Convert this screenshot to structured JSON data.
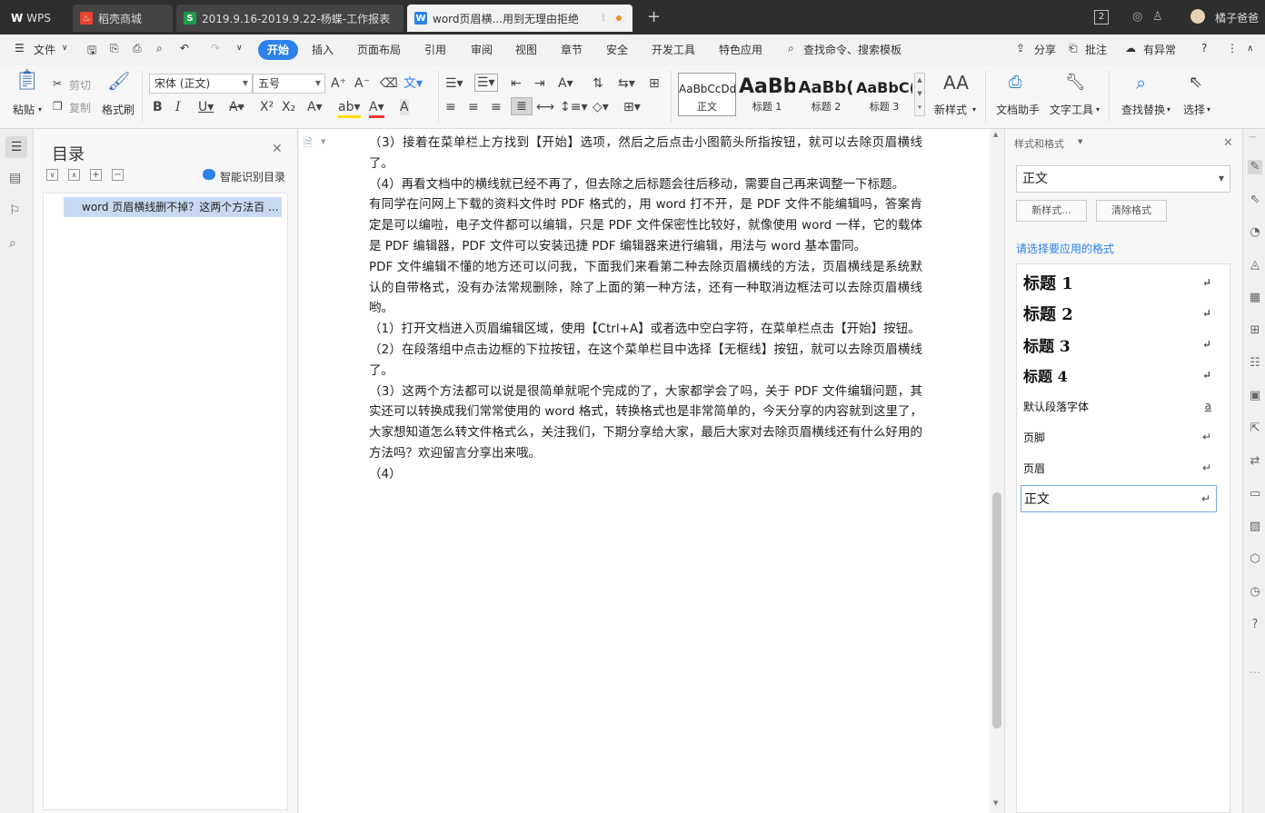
{
  "titlebar": {
    "tabs": [
      {
        "label": "WPS",
        "icon": "wps-logo-icon"
      },
      {
        "label": "稻壳商城",
        "icon": "docer-flame-icon"
      },
      {
        "label": "2019.9.16-2019.9.22-杨蝶-工作报表",
        "icon": "sheet-s-icon"
      },
      {
        "label": "word页眉横...用到无理由拒绝",
        "icon": "writer-w-icon"
      }
    ],
    "new_tab": "+",
    "window_count": "2",
    "user_name": "橘子爸爸"
  },
  "menubar": {
    "file": "文件",
    "tabs": [
      "开始",
      "插入",
      "页面布局",
      "引用",
      "审阅",
      "视图",
      "章节",
      "安全",
      "开发工具",
      "特色应用"
    ],
    "search_placeholder": "查找命令、搜索模板",
    "share": "分享",
    "comment": "批注",
    "anomaly": "有异常",
    "help": "?"
  },
  "ribbon": {
    "paste": "粘贴",
    "cut": "剪切",
    "copy": "复制",
    "format_painter": "格式刷",
    "font_name": "宋体 (正文)",
    "font_size": "五号",
    "styles": [
      {
        "preview": "AaBbCcDd",
        "name": "正文"
      },
      {
        "preview": "AaBb",
        "name": "标题 1"
      },
      {
        "preview": "AaBb(",
        "name": "标题 2"
      },
      {
        "preview": "AaBbC(",
        "name": "标题 3"
      }
    ],
    "new_style": "新样式",
    "doc_assistant": "文档助手",
    "text_tools": "文字工具",
    "find_replace": "查找替换",
    "select": "选择"
  },
  "toc": {
    "title": "目录",
    "smart_detect": "智能识别目录",
    "items": [
      "word 页眉横线删不掉？这两个方法百 ..."
    ]
  },
  "document": {
    "paragraphs": [
      "（3）接着在菜单栏上方找到【开始】选项，然后之后点击小图箭头所指按钮，就可以去除页眉横线了。",
      "（4）再看文档中的横线就已经不再了，但去除之后标题会往后移动，需要自己再来调整一下标题。",
      "有同学在问网上下载的资料文件时 PDF 格式的，用 word 打不开，是 PDF 文件不能编辑吗，答案肯定是可以编啦，电子文件都可以编辑，只是 PDF 文件保密性比较好，就像使用 word 一样，它的载体是 PDF 编辑器，PDF 文件可以安装迅捷 PDF 编辑器来进行编辑，用法与 word 基本雷同。",
      "PDF 文件编辑不懂的地方还可以问我，下面我们来看第二种去除页眉横线的方法，页眉横线是系统默认的自带格式，没有办法常规删除，除了上面的第一种方法，还有一种取消边框法可以去除页眉横线哟。",
      "（1）打开文档进入页眉编辑区域，使用【Ctrl+A】或者选中空白字符，在菜单栏点击【开始】按钮。",
      "（2）在段落组中点击边框的下拉按钮，在这个菜单栏目中选择【无框线】按钮，就可以去除页眉横线了。",
      "（3）这两个方法都可以说是很简单就呢个完成的了，大家都学会了吗，关于 PDF 文件编辑问题，其实还可以转换成我们常常使用的 word 格式，转换格式也是非常简单的，今天分享的内容就到这里了，大家想知道怎么转文件格式么，关注我们，下期分享给大家，最后大家对去除页眉横线还有什么好用的方法吗？欢迎留言分享出来哦。",
      "（4）"
    ]
  },
  "style_panel": {
    "title": "样式和格式",
    "current_style": "正文",
    "new_style_btn": "新样式...",
    "clear_format_btn": "清除格式",
    "apply_prompt": "请选择要应用的格式",
    "styles": [
      {
        "name": "标题  1",
        "mark": "↵"
      },
      {
        "name": "标题  2",
        "mark": "↵"
      },
      {
        "name": "标题  3",
        "mark": "↵"
      },
      {
        "name": "标题  4",
        "mark": "↵"
      },
      {
        "name": "默认段落字体",
        "mark": "a"
      },
      {
        "name": "页脚",
        "mark": "↵"
      },
      {
        "name": "页眉",
        "mark": "↵"
      },
      {
        "name": "正文",
        "mark": "↵"
      }
    ]
  }
}
